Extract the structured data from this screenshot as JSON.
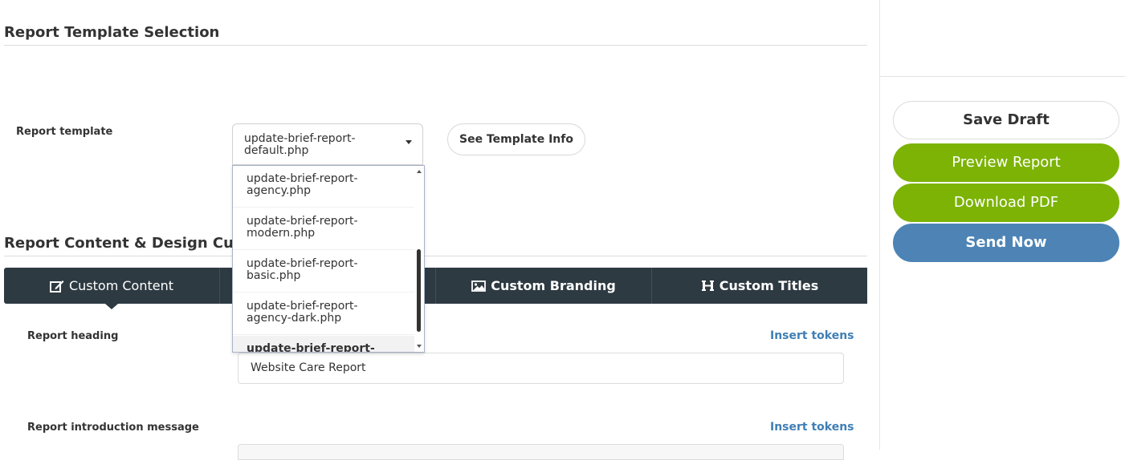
{
  "sections": {
    "template_selection_title": "Report Template Selection",
    "content_design_title": "Report Content & Design Customization"
  },
  "template": {
    "label": "Report template",
    "selected_value": "update-brief-report-default.php",
    "selected_line1": "update-brief-report-",
    "selected_line2": "default.php",
    "options": [
      {
        "line1": "update-brief-report-",
        "line2": "agency.php"
      },
      {
        "line1": "update-brief-report-",
        "line2": "modern.php"
      },
      {
        "line1": "update-brief-report-",
        "line2": "basic.php"
      },
      {
        "line1": "update-brief-report-",
        "line2": "agency-dark.php"
      },
      {
        "line1": "update-brief-report-",
        "line2": ""
      }
    ],
    "info_button": "See Template Info"
  },
  "tabs": [
    {
      "label": "Custom Content",
      "icon": "edit-icon"
    },
    {
      "label": "",
      "icon": ""
    },
    {
      "label": "Custom Branding",
      "icon": "image-icon"
    },
    {
      "label": "Custom Titles",
      "icon": "heading-icon"
    }
  ],
  "fields": {
    "heading_label": "Report heading",
    "heading_value": "Website Care Report",
    "intro_label": "Report introduction message",
    "insert_tokens": "Insert tokens"
  },
  "sidebar": {
    "save_draft": "Save Draft",
    "preview": "Preview Report",
    "download_pdf": "Download PDF",
    "send_now": "Send Now"
  },
  "colors": {
    "tabbar": "#2e3a42",
    "green": "#7cb305",
    "blue": "#4d84b5",
    "link": "#3f7fb5"
  }
}
